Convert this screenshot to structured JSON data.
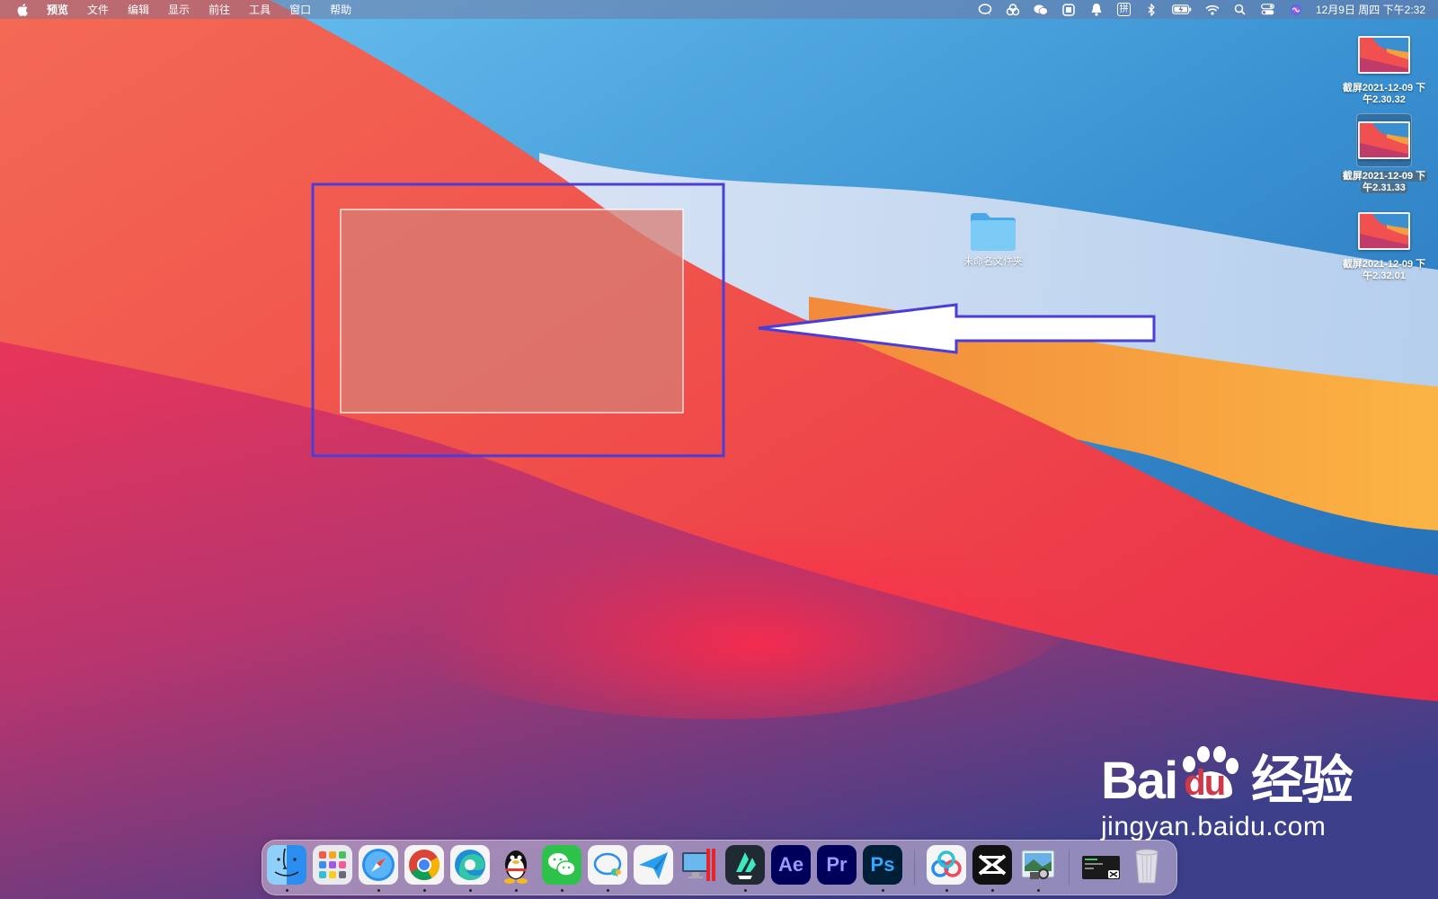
{
  "menubar": {
    "app_name": "预览",
    "menus": [
      "文件",
      "编辑",
      "显示",
      "前往",
      "工具",
      "窗口",
      "帮助"
    ],
    "tray_icons": [
      "chat-bubble-icon",
      "baidu-netdisk-icon",
      "wechat-icon",
      "rectangle-icon",
      "notification-bell-icon",
      "input-method-icon",
      "bluetooth-icon",
      "battery-icon",
      "wifi-icon",
      "spotlight-search-icon",
      "control-center-icon",
      "siri-icon"
    ],
    "input_method_label": "拼",
    "clock": "12月9日 周四 下午2:32"
  },
  "desktop": {
    "files": [
      {
        "name_line1": "截屏2021-12-09 下",
        "name_line2": "午2.30.32",
        "selected": false
      },
      {
        "name_line1": "截屏2021-12-09 下",
        "name_line2": "午2.31.33",
        "selected": true
      },
      {
        "name_line1": "截屏2021-12-09 下",
        "name_line2": "午2.32.01",
        "selected": false
      }
    ],
    "folder": {
      "name": "未命名文件夹"
    }
  },
  "dock": {
    "apps": [
      {
        "name": "Finder",
        "icon": "finder-icon",
        "running": true
      },
      {
        "name": "Launchpad",
        "icon": "launchpad-icon",
        "running": false
      },
      {
        "name": "Safari",
        "icon": "safari-icon",
        "running": true
      },
      {
        "name": "Chrome",
        "icon": "chrome-icon",
        "running": true
      },
      {
        "name": "Edge",
        "icon": "edge-icon",
        "running": true
      },
      {
        "name": "QQ",
        "icon": "qq-icon",
        "running": true
      },
      {
        "name": "WeChat",
        "icon": "wechat-icon",
        "running": true
      },
      {
        "name": "Messages",
        "icon": "chat-bubble-icon",
        "running": true
      },
      {
        "name": "Telegram",
        "icon": "paper-plane-icon",
        "running": false
      },
      {
        "name": "Parallels",
        "icon": "parallels-icon",
        "running": false
      },
      {
        "name": "Filmora",
        "icon": "filmora-icon",
        "running": true
      },
      {
        "name": "After Effects",
        "icon": "after-effects-icon",
        "label": "Ae",
        "running": false
      },
      {
        "name": "Premiere Pro",
        "icon": "premiere-pro-icon",
        "label": "Pr",
        "running": false
      },
      {
        "name": "Photoshop",
        "icon": "photoshop-icon",
        "label": "Ps",
        "running": true
      },
      {
        "name": "Baidu Netdisk",
        "icon": "baidu-netdisk-icon",
        "running": true
      },
      {
        "name": "CapCut",
        "icon": "capcut-icon",
        "running": true
      },
      {
        "name": "Preview",
        "icon": "preview-icon",
        "running": true
      },
      {
        "name": "Screen Recorder",
        "icon": "screen-recorder-icon",
        "running": false
      },
      {
        "name": "Trash",
        "icon": "trash-icon",
        "running": false
      }
    ]
  },
  "watermark": {
    "brand_part1": "Bai",
    "brand_part2": "du",
    "brand_part3": "经验",
    "url": "jingyan.baidu.com"
  },
  "colors": {
    "annotation_blue": "#4a3ed6",
    "menubar_text": "#ffffff"
  }
}
